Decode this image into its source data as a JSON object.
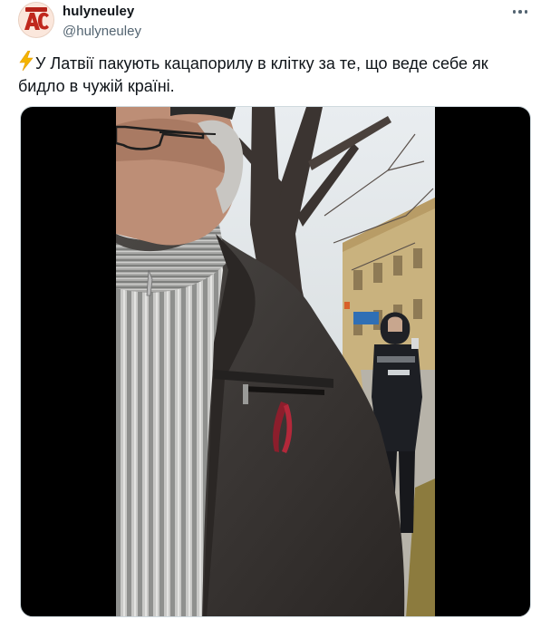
{
  "author": {
    "display_name": "hulyneuley",
    "handle": "@hulyneuley",
    "avatar_text": "AC"
  },
  "tweet": {
    "emoji_icon": "high-voltage-icon",
    "text": "У Латвії пакують кацапорилу в клітку за те, що веде себе як бидло в чужій країні."
  },
  "media": {
    "type": "video",
    "description_icon": "video-frame"
  },
  "colors": {
    "text": "#0f1419",
    "secondary": "#536471",
    "media_bg": "#000000",
    "bolt": "#f4b400"
  }
}
